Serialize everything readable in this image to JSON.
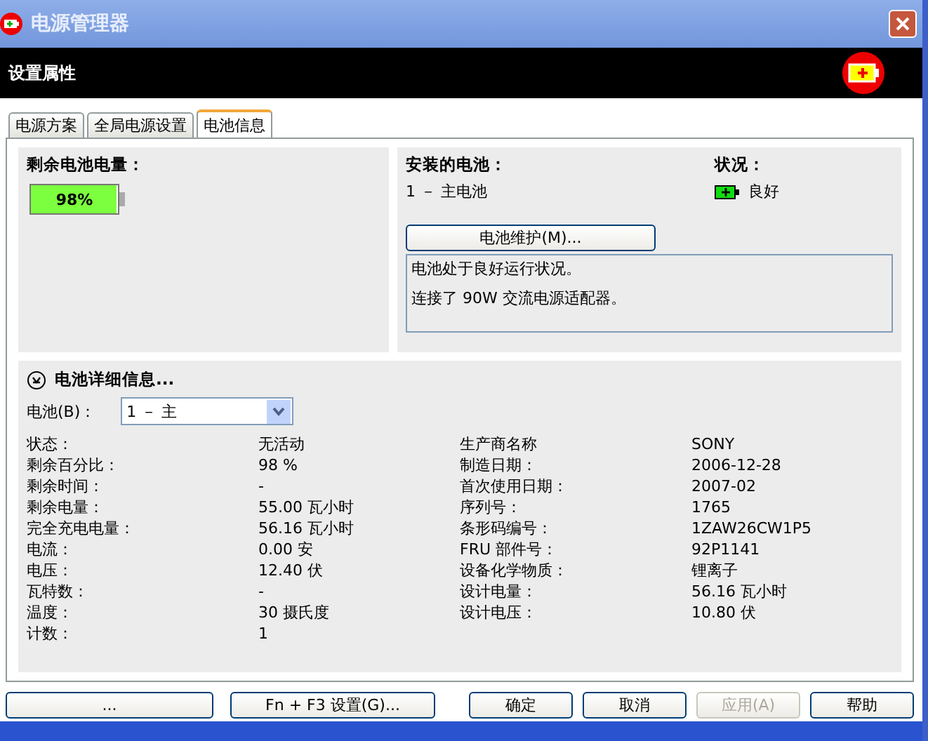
{
  "window": {
    "title": "电源管理器"
  },
  "header": {
    "title": "设置属性"
  },
  "tabs": [
    {
      "label": "电源方案",
      "selected": false
    },
    {
      "label": "全局电源设置",
      "selected": false
    },
    {
      "label": "电池信息",
      "selected": true
    }
  ],
  "remaining": {
    "label": "剩余电池电量：",
    "level": 0.98,
    "reading": "98%"
  },
  "installed": {
    "label": "安装的电池：",
    "value": "1 － 主电池"
  },
  "condition": {
    "label": "状况：",
    "value": "良好"
  },
  "maintenance_button": "电池维护(M)...",
  "messages": [
    "电池处于良好运行状况。",
    "连接了 90W 交流电源适配器。"
  ],
  "details": {
    "title": "电池详细信息...",
    "expanded": true,
    "battery_label": "电池(B)：",
    "battery_value": "1 － 主",
    "left": [
      {
        "label": "状态：",
        "value": "无活动"
      },
      {
        "label": "剩余百分比：",
        "value": "98 %"
      },
      {
        "label": "剩余时间：",
        "value": "-"
      },
      {
        "label": "剩余电量：",
        "value": "55.00 瓦小时"
      },
      {
        "label": "完全充电电量：",
        "value": "56.16 瓦小时"
      },
      {
        "label": "电流：",
        "value": "0.00 安"
      },
      {
        "label": "电压：",
        "value": "12.40 伏"
      },
      {
        "label": "瓦特数：",
        "value": "-"
      },
      {
        "label": "温度：",
        "value": "30 摄氏度"
      },
      {
        "label": "计数：",
        "value": "1"
      }
    ],
    "right": [
      {
        "label": "生产商名称",
        "value": "SONY"
      },
      {
        "label": "制造日期：",
        "value": "2006-12-28"
      },
      {
        "label": "首次使用日期：",
        "value": "2007-02"
      },
      {
        "label": "序列号：",
        "value": "1765"
      },
      {
        "label": "条形码编号：",
        "value": "1ZAW26CW1P5"
      },
      {
        "label": "FRU 部件号：",
        "value": "92P1141"
      },
      {
        "label": "设备化学物质：",
        "value": "锂离子"
      },
      {
        "label": "设计电量：",
        "value": "56.16 瓦小时"
      },
      {
        "label": "设计电压：",
        "value": "10.80 伏"
      }
    ]
  },
  "left_buttons": [
    {
      "label": "...",
      "disabled": false
    },
    {
      "label": "Fn + F3 设置(G)...",
      "disabled": false
    }
  ],
  "buttons": [
    {
      "label": "确定",
      "disabled": false
    },
    {
      "label": "取消",
      "disabled": false
    },
    {
      "label": "应用(A)",
      "disabled": true
    },
    {
      "label": "帮助",
      "disabled": false
    }
  ]
}
